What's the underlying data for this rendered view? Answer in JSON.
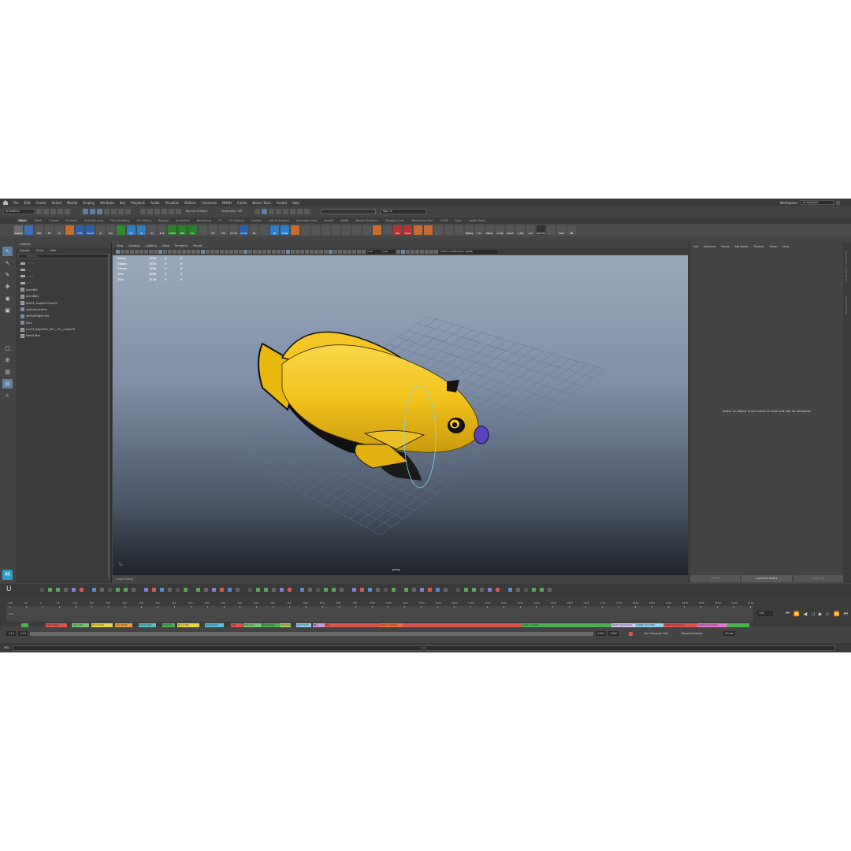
{
  "menus": [
    "File",
    "Edit",
    "Create",
    "Select",
    "Modify",
    "Display",
    "Windows",
    "Key",
    "Playback",
    "Audio",
    "Visualize",
    "Deform",
    "Constrain",
    "MASH",
    "Cache",
    "Bonus Tools",
    "Arnold",
    "Help"
  ],
  "workspace": {
    "label": "Workspace:",
    "value": "Animation*"
  },
  "status": {
    "mode": "Animation",
    "live_surface": "No Live Surface",
    "symmetry": "Symmetry: Off",
    "sign_in": "Sign In"
  },
  "shelf_tabs": [
    "Work",
    "Mesh",
    "Curves",
    "Surfaces",
    "Sets/Skinning",
    "Poly Modeling",
    "UV Editing",
    "Rigging",
    "Animation",
    "Rendering",
    "FX",
    "FX Caching",
    "Custom",
    "Adv Animation",
    "Animation User",
    "Arnold",
    "MASH",
    "Motion Graphics",
    "Polygons User",
    "Rendering User",
    "XGEN",
    "Xgen",
    "ngSkinTools"
  ],
  "shelf_active": "Work",
  "shelf_icons": [
    {
      "label": "resetver",
      "color": "#6b6b6b"
    },
    {
      "label": "",
      "color": "#3f6fb6"
    },
    {
      "label": "TGM",
      "color": "#555"
    },
    {
      "label": "BT",
      "color": "#555"
    },
    {
      "label": "CF",
      "color": "#555"
    },
    {
      "label": "",
      "color": "#c76b2e"
    },
    {
      "label": "CTRL",
      "color": "#2d5ea8"
    },
    {
      "label": "CV↔CR",
      "color": "#2d5ea8"
    },
    {
      "label": "JS",
      "color": "#555"
    },
    {
      "label": "Blo",
      "color": "#555"
    },
    {
      "label": "",
      "color": "#2e8b2e"
    },
    {
      "label": "Trsn",
      "color": "#2b7fc7"
    },
    {
      "label": "BJ",
      "color": "#2b7fc7"
    },
    {
      "label": "IR",
      "color": "#555"
    },
    {
      "label": "R→S",
      "color": "#555"
    },
    {
      "label": "CONST",
      "color": "#2a7f2a"
    },
    {
      "label": "REC",
      "color": "#2a7f2a"
    },
    {
      "label": "Dyn",
      "color": "#2a7f2a"
    },
    {
      "label": "",
      "color": "#555"
    },
    {
      "label": "MT",
      "color": "#555"
    },
    {
      "label": "MR",
      "color": "#555"
    },
    {
      "label": "M T→R",
      "color": "#555"
    },
    {
      "label": "Constr",
      "color": "#2d5ea8"
    },
    {
      "label": "BS",
      "color": "#555"
    },
    {
      "label": "",
      "color": "#555"
    },
    {
      "label": "BS",
      "color": "#2b7fc7"
    },
    {
      "label": "Cutter",
      "color": "#2b7fc7"
    },
    {
      "label": "",
      "color": "#c76b2e"
    },
    {
      "label": "",
      "color": "#555"
    },
    {
      "label": "",
      "color": "#555"
    },
    {
      "label": "",
      "color": "#555"
    },
    {
      "label": "",
      "color": "#555"
    },
    {
      "label": "",
      "color": "#555"
    },
    {
      "label": "",
      "color": "#555"
    },
    {
      "label": "",
      "color": "#555"
    },
    {
      "label": "",
      "color": "#c76b2e"
    },
    {
      "label": "",
      "color": "#555"
    },
    {
      "label": "Bez",
      "color": "#b83232"
    },
    {
      "label": "Direct",
      "color": "#b83232"
    },
    {
      "label": "",
      "color": "#c76b2e"
    },
    {
      "label": "",
      "color": "#c76b2e"
    },
    {
      "label": "",
      "color": "#555"
    },
    {
      "label": "",
      "color": "#555"
    },
    {
      "label": "",
      "color": "#555"
    },
    {
      "label": "ON/Seg",
      "color": "#555"
    },
    {
      "label": "hm",
      "color": "#555"
    },
    {
      "label": "Ribbon",
      "color": "#555"
    },
    {
      "label": "cv-dup",
      "color": "#555"
    },
    {
      "label": "export",
      "color": "#555"
    },
    {
      "label": "S_Obj",
      "color": "#555"
    },
    {
      "label": "R-U",
      "color": "#555"
    },
    {
      "label": "DynChain",
      "color": "#333"
    },
    {
      "label": "",
      "color": "#555"
    },
    {
      "label": "Cbso",
      "color": "#555"
    },
    {
      "label": "BB",
      "color": "#555"
    }
  ],
  "outliner": {
    "title": "Outliner",
    "menu": [
      "Display",
      "Show",
      "Help"
    ],
    "search_placeholder": "Search...",
    "items": [
      {
        "label": "persp",
        "dim": true,
        "kind": "cam"
      },
      {
        "label": "top",
        "dim": true,
        "kind": "cam"
      },
      {
        "label": "front",
        "dim": true,
        "kind": "cam"
      },
      {
        "label": "side",
        "dim": true,
        "kind": "cam"
      },
      {
        "label": "animBot",
        "dim": false,
        "kind": "grp"
      },
      {
        "label": "animBot1",
        "dim": false,
        "kind": "grp"
      },
      {
        "label": "fish01_angelfishYeaplh",
        "dim": false,
        "kind": "grp"
      },
      {
        "label": "defaultLightSet",
        "dim": false,
        "kind": "set"
      },
      {
        "label": "defaultObjectSet",
        "dim": false,
        "kind": "set"
      },
      {
        "label": "flats",
        "dim": false,
        "kind": "set"
      },
      {
        "label": "rou24_angelfish_HiG__33__readyFN",
        "dim": false,
        "kind": "grp"
      },
      {
        "label": "MeshLiftor",
        "dim": false,
        "kind": "grp"
      }
    ]
  },
  "viewport": {
    "menu": [
      "View",
      "Shading",
      "Lighting",
      "Show",
      "Renderer",
      "Panels"
    ],
    "near": "0.00",
    "far": "1.00",
    "colorspace": "ACES 1.0 SDR-video (sRGB)",
    "hud": [
      {
        "label": "Verts:",
        "values": [
          "1984",
          "0",
          "0"
        ]
      },
      {
        "label": "Edges:",
        "values": [
          "3958",
          "0",
          "0"
        ]
      },
      {
        "label": "Faces:",
        "values": [
          "1988",
          "0",
          "0"
        ]
      },
      {
        "label": "Tris:",
        "values": [
          "3962",
          "0",
          "0"
        ]
      },
      {
        "label": "UVs:",
        "values": [
          "1718",
          "0",
          "0"
        ]
      }
    ],
    "camera_label": "persp",
    "footer": "Graph Editor"
  },
  "attribute_editor": {
    "menu": [
      "List",
      "Selected",
      "Focus",
      "Attributes",
      "Display",
      "Show",
      "Help"
    ],
    "message": "Select an object in the scene to view and edit its attributes",
    "buttons": [
      "Select",
      "Load Attributes",
      "Copy Tab"
    ]
  },
  "side_tabs": [
    "Channel Box / Layer Editor",
    "Attribute Editor"
  ],
  "timeline": {
    "ticks": [
      "-100",
      "-50",
      "0",
      "50",
      "100",
      "150",
      "200",
      "250",
      "300",
      "350",
      "400",
      "450",
      "500",
      "550",
      "600",
      "650",
      "700",
      "750",
      "800",
      "850",
      "900",
      "950",
      "1000",
      "1050",
      "1100",
      "1150",
      "1200",
      "1250",
      "1300",
      "1350",
      "1400",
      "1450",
      "1500",
      "1550",
      "1600",
      "1650",
      "1700",
      "1750",
      "1800",
      "1850",
      "1900",
      "1950",
      "2000",
      "2050",
      "2100",
      "2150"
    ],
    "start_label": "-110",
    "current_frame": "110",
    "clips": [
      {
        "label": "",
        "color": "#4caf50",
        "start": 0.02,
        "end": 0.03
      },
      {
        "label": "Swim1 Slow",
        "color": "#d9534f",
        "start": 0.053,
        "end": 0.081
      },
      {
        "label": "Swim Fast",
        "color": "#7cc576",
        "start": 0.088,
        "end": 0.111
      },
      {
        "label": "Turn R Slow",
        "color": "#e8d44d",
        "start": 0.114,
        "end": 0.142
      },
      {
        "label": "Turn R Fast",
        "color": "#e8a03d",
        "start": 0.146,
        "end": 0.169
      },
      {
        "label": "Swim2 Slow",
        "color": "#5bc0be",
        "start": 0.177,
        "end": 0.2
      },
      {
        "label": "Drop Fw",
        "color": "#4caf50",
        "start": 0.209,
        "end": 0.226
      },
      {
        "label": "Turn L Fast",
        "color": "#e8d44d",
        "start": 0.229,
        "end": 0.258
      },
      {
        "label": "Swim3 Fast",
        "color": "#5bc0de",
        "start": 0.266,
        "end": 0.291
      },
      {
        "label": "Idle",
        "color": "#d9534f",
        "start": 0.301,
        "end": 0.316
      },
      {
        "label": "Fast Swim",
        "color": "#7cc576",
        "start": 0.318,
        "end": 0.342
      },
      {
        "label": "Fast Dorsal",
        "color": "#4caf50",
        "start": 0.343,
        "end": 0.367
      },
      {
        "label": "Fast Down",
        "color": "#b0d060",
        "start": 0.367,
        "end": 0.381
      },
      {
        "label": "Swim Fast2",
        "color": "#8fd3f0",
        "start": 0.388,
        "end": 0.408
      },
      {
        "label": "Bite",
        "color": "#c59be0",
        "start": 0.41,
        "end": 0.426
      },
      {
        "label": "Idle",
        "color": "#d9534f",
        "start": 0.426,
        "end": 0.5
      },
      {
        "label": "Swim Long Slow",
        "color": "#e8703d",
        "start": 0.5,
        "end": 0.53
      },
      {
        "label": "",
        "color": "#d9534f",
        "start": 0.53,
        "end": 0.69
      },
      {
        "label": "Swim Long Fast",
        "color": "#4caf50",
        "start": 0.69,
        "end": 0.727
      },
      {
        "label": "",
        "color": "#4caf50",
        "start": 0.727,
        "end": 0.81
      },
      {
        "label": "Death1 (Sink Slow)",
        "color": "#d0c8f0",
        "start": 0.81,
        "end": 0.842
      },
      {
        "label": "Death1 (Sink Fast)",
        "color": "#8fd3f0",
        "start": 0.842,
        "end": 0.88
      },
      {
        "label": "Death2 (Float Slow)",
        "color": "#d9534f",
        "start": 0.88,
        "end": 0.925
      },
      {
        "label": "Death2 (Float Fast)",
        "color": "#e07ad0",
        "start": 0.925,
        "end": 0.965
      },
      {
        "label": "",
        "color": "#4caf50",
        "start": 0.965,
        "end": 0.995
      }
    ]
  },
  "range": {
    "start": "-110",
    "inner_start": "-110",
    "inner_end": "2160",
    "end": "2160",
    "character_set": "No Character Set",
    "anim_layer": "BaseAnimation",
    "fps": "30 fps"
  },
  "command_line": {
    "label": "MEL"
  }
}
